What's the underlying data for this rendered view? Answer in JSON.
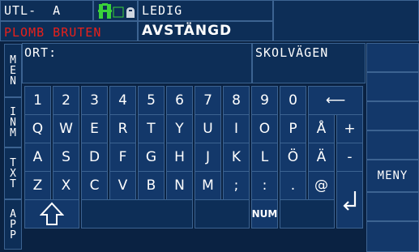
{
  "header": {
    "unit_id": "UTL-  A",
    "alarm": "PLOMB BRUTEN",
    "status": "LEDIG",
    "mode": "AVSTÄNGD",
    "alarm_color": "#e8201a",
    "icon_color": "#3ad23a"
  },
  "tabs": [
    {
      "name": "MEN",
      "chars": [
        "M",
        "E",
        "N"
      ]
    },
    {
      "name": "INM",
      "chars": [
        "I",
        "N",
        "M"
      ]
    },
    {
      "name": "TXT",
      "chars": [
        "T",
        "X",
        "T"
      ]
    },
    {
      "name": "APP",
      "chars": [
        "A",
        "P",
        "P"
      ]
    }
  ],
  "form": {
    "field_label": "ORT:",
    "field_value": "SKOLVÄGEN"
  },
  "keyboard": {
    "row1": [
      "1",
      "2",
      "3",
      "4",
      "5",
      "6",
      "7",
      "8",
      "9",
      "0",
      "⟵"
    ],
    "row2": [
      "Q",
      "W",
      "E",
      "R",
      "T",
      "Y",
      "U",
      "I",
      "O",
      "P",
      "Å",
      "+"
    ],
    "row3": [
      "A",
      "S",
      "D",
      "F",
      "G",
      "H",
      "J",
      "K",
      "L",
      "Ö",
      "Ä",
      "-"
    ],
    "row4": [
      "Z",
      "X",
      "C",
      "V",
      "B",
      "N",
      "M",
      ";",
      ":",
      ".",
      "@"
    ],
    "shift_icon": "shift-icon",
    "num_label": "NUM",
    "enter_icon": "enter-icon"
  },
  "side": {
    "meny_label": "MENY"
  }
}
